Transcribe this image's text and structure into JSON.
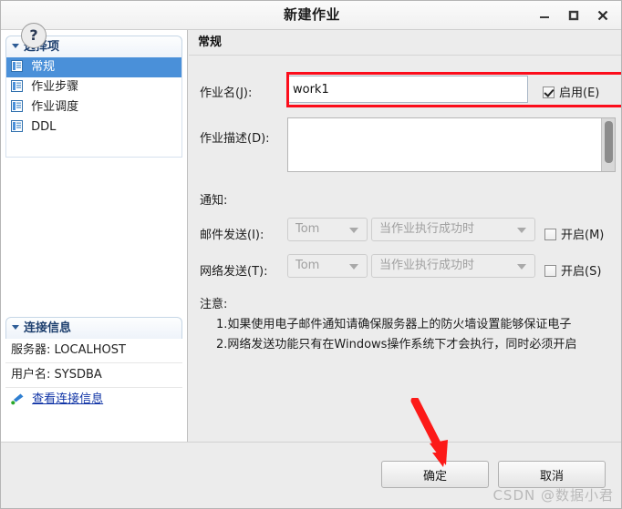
{
  "window": {
    "title": "新建作业",
    "minimize_label": "_",
    "maximize_label": "□",
    "close_label": "✕"
  },
  "sidebar": {
    "options_panel": {
      "header": "选择项",
      "items": [
        {
          "label": "常规",
          "selected": true
        },
        {
          "label": "作业步骤",
          "selected": false
        },
        {
          "label": "作业调度",
          "selected": false
        },
        {
          "label": "DDL",
          "selected": false
        }
      ]
    },
    "connection_panel": {
      "header": "连接信息",
      "server_label": "服务器:",
      "server_value": "LOCALHOST",
      "user_label": "用户名:",
      "user_value": "SYSDBA",
      "link_label": "查看连接信息"
    }
  },
  "content": {
    "header": "常规",
    "job_name_label": "作业名(J):",
    "job_name_value": "work1",
    "enable_checkbox_label": "启用(E)",
    "enable_checkbox_checked": true,
    "job_desc_label": "作业描述(D):",
    "job_desc_value": "",
    "notify_label": "通知:",
    "mail_label": "邮件发送(I):",
    "mail_recipient": "Tom",
    "mail_condition": "当作业执行成功时",
    "mail_enable_label": "开启(M)",
    "mail_enable_checked": false,
    "net_label": "网络发送(T):",
    "net_recipient": "Tom",
    "net_condition": "当作业执行成功时",
    "net_enable_label": "开启(S)",
    "net_enable_checked": false,
    "note_title": "注意:",
    "note_line_1": "1.如果使用电子邮件通知请确保服务器上的防火墙设置能够保证电子",
    "note_line_2": "2.网络发送功能只有在Windows操作系统下才会执行，同时必须开启"
  },
  "footer": {
    "help_label": "?",
    "ok_label": "确定",
    "cancel_label": "取消"
  },
  "watermark": "CSDN @数据小君",
  "colors": {
    "selection_blue": "#4a90d9",
    "annotation_red": "#fc0d1b",
    "link_blue": "#1034a6",
    "panel_header_text": "#1d3f6e"
  }
}
